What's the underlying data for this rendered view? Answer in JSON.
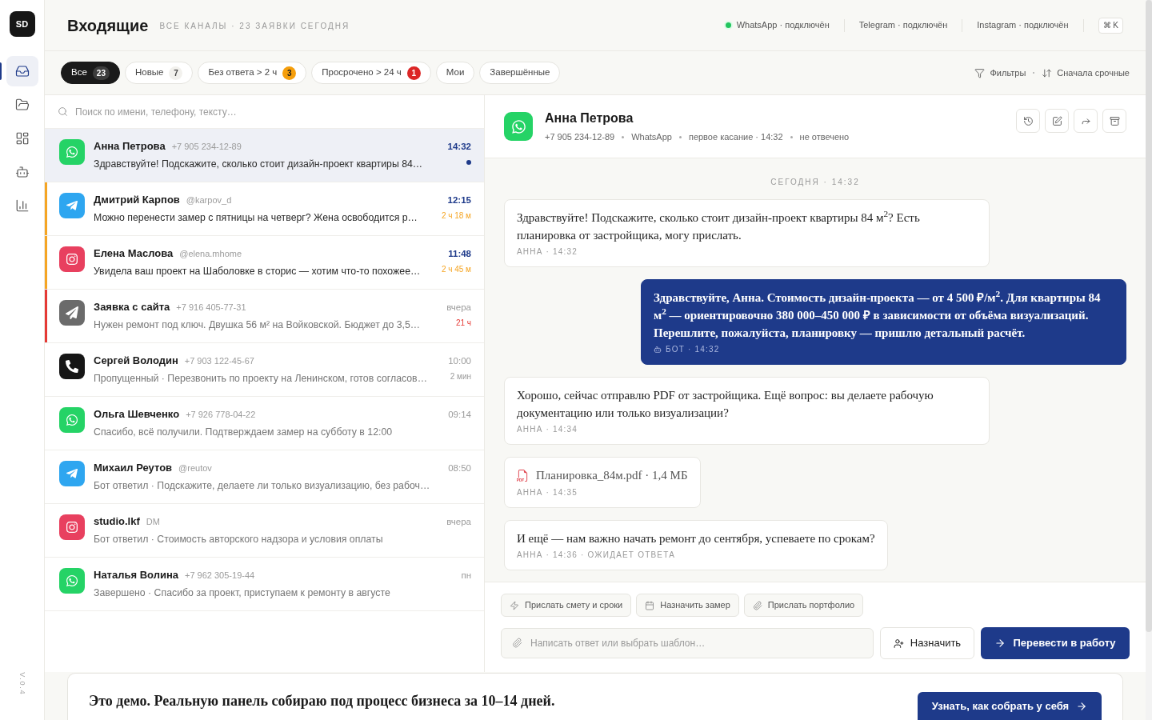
{
  "sidebar": {
    "logo": "SD",
    "nav": [
      {
        "kind": "inbox",
        "selected": true
      },
      {
        "kind": "folder",
        "selected": false
      },
      {
        "kind": "board",
        "selected": false
      },
      {
        "kind": "bot",
        "selected": false
      },
      {
        "kind": "chart",
        "selected": false
      }
    ],
    "version": "V.0.4"
  },
  "header": {
    "title": "Входящие",
    "subtitle": "ВСЕ КАНАЛЫ · 23 ЗАЯВКИ СЕГОДНЯ",
    "channels": [
      {
        "label": "WhatsApp · подключён",
        "dot": true
      },
      {
        "label": "Telegram · подключён",
        "dot": false
      },
      {
        "label": "Instagram · подключён",
        "dot": false
      }
    ],
    "shortcut": "⌘ K"
  },
  "filters": {
    "tabs": [
      {
        "label": "Все",
        "count": "23",
        "kind": "neutral",
        "selected": true
      },
      {
        "label": "Новые",
        "count": "7",
        "kind": "neutral",
        "selected": false
      },
      {
        "label": "Без ответа > 2 ч",
        "count": "3",
        "kind": "warning",
        "selected": false
      },
      {
        "label": "Просрочено > 24 ч",
        "count": "1",
        "kind": "danger",
        "selected": false
      },
      {
        "label": "Мои",
        "selected": false
      },
      {
        "label": "Завершённые",
        "selected": false
      }
    ],
    "filter_button": "Фильтры",
    "sort_button": "Сначала срочные"
  },
  "search": {
    "placeholder": "Поиск по имени, телефону, тексту…"
  },
  "conversations": [
    {
      "kind": "whatsapp",
      "name": "Анна Петрова",
      "handle": "+7 905 234-12-89",
      "preview": "Здравствуйте! Подскажите, сколько стоит дизайн-проект квартиры 84…",
      "time": "14:32",
      "unread": true,
      "selected": true
    },
    {
      "kind": "telegram",
      "name": "Дмитрий Карпов",
      "handle": "@karpov_d",
      "preview": "Можно перенести замер с пятницы на четверг? Жена освободится р…",
      "time": "12:15",
      "wait": "2 ч 18 м",
      "color": "#f5a524",
      "unread": true,
      "selected": false
    },
    {
      "kind": "instagram",
      "name": "Елена Маслова",
      "handle": "@elena.mhome",
      "preview": "Увидела ваш проект на Шаболовке в сторис — хотим что-то похожее…",
      "time": "11:48",
      "wait": "2 ч 45 м",
      "color": "#f5a524",
      "unread": true,
      "selected": false
    },
    {
      "kind": "site",
      "name": "Заявка с сайта",
      "handle": "+7 916 405-77-31",
      "preview": "Нужен ремонт под ключ. Двушка 56 м² на Войковской. Бюджет до 3,5…",
      "time": "вчера",
      "wait": "21 ч",
      "color": "#e53935",
      "unread": false,
      "selected": false
    },
    {
      "kind": "phone",
      "name": "Сергей Володин",
      "handle": "+7 903 122-45-67",
      "preview": "Пропущенный · Перезвонить по проекту на Ленинском, готов согласов…",
      "time": "10:00",
      "wait": "2 мин",
      "unread": false,
      "selected": false
    },
    {
      "kind": "whatsapp",
      "name": "Ольга Шевченко",
      "handle": "+7 926 778-04-22",
      "preview": "Спасибо, всё получили. Подтверждаем замер на субботу в 12:00",
      "time": "09:14",
      "unread": false,
      "selected": false
    },
    {
      "kind": "telegram",
      "name": "Михаил Реутов",
      "handle": "@reutov",
      "preview": "Бот ответил · Подскажите, делаете ли только визуализацию, без рабоч…",
      "time": "08:50",
      "unread": false,
      "selected": false
    },
    {
      "kind": "instagram",
      "name": "studio.lkf",
      "handle": "DM",
      "preview": "Бот ответил · Стоимость авторского надзора и условия оплаты",
      "time": "вчера",
      "unread": false,
      "selected": false
    },
    {
      "kind": "whatsapp",
      "name": "Наталья Волина",
      "handle": "+7 962 305-19-44",
      "preview": "Завершено · Спасибо за проект, приступаем к ремонту в августе",
      "time": "пн",
      "unread": false,
      "selected": false
    }
  ],
  "chat": {
    "contact": {
      "kind": "whatsapp",
      "name": "Анна Петрова",
      "meta": [
        "+7 905 234-12-89",
        "WhatsApp",
        "первое касание · 14:32",
        "не отвечено"
      ]
    },
    "actions": [
      {
        "kind": "history"
      },
      {
        "kind": "edit"
      },
      {
        "kind": "forward"
      },
      {
        "kind": "archive"
      }
    ],
    "date_divider": "СЕГОДНЯ · 14:32",
    "messages": [
      {
        "kind": "incoming",
        "text": "Здравствуйте! Подскажите, сколько стоит дизайн-проект квартиры 84 м$^{2}$? Есть планировка от застройщика, могу прислать.",
        "meta": "АННА · 14:32",
        "bot": false
      },
      {
        "kind": "outgoing",
        "text": "Здравствуйте, Анна. Стоимость дизайн-проекта — от 4 500 ₽/м$^{2}$. Для квартиры 84 м$^{2}$ — ориентировочно 380 000–450 000 ₽ в зависимости от объёма визуализаций. Перешлите, пожалуйста, планировку — пришлю детальный расчёт.",
        "meta": "БОТ · 14:32",
        "bot": true
      },
      {
        "kind": "incoming",
        "text": "Хорошо, сейчас отправлю PDF от застройщика. Ещё вопрос: вы делаете рабочую документацию или только визуализации?",
        "meta": "АННА · 14:34",
        "bot": false
      },
      {
        "kind": "file",
        "text": "Планировка_84м.pdf · 1,4 МБ",
        "meta": "АННА · 14:35",
        "bot": false
      },
      {
        "kind": "incoming",
        "text": "И ещё — нам важно начать ремонт до сентября, успеваете по срокам?",
        "meta": "АННА · 14:36 · ОЖИДАЕТ ОТВЕТА",
        "bot": false
      }
    ]
  },
  "composer": {
    "quick_replies": [
      {
        "kind": "lightning",
        "label": "Прислать смету и сроки"
      },
      {
        "kind": "calendar",
        "label": "Назначить замер"
      },
      {
        "kind": "attach",
        "label": "Прислать портфолио"
      }
    ],
    "placeholder": "Написать ответ или выбрать шаблон…",
    "assign_button": "Назначить",
    "primary_button": "Перевести в работу"
  },
  "banner": {
    "text": "Это демо. Реальную панель собираю под процесс бизнеса за 10–14 дней.",
    "button": "Узнать, как собрать у себя"
  }
}
